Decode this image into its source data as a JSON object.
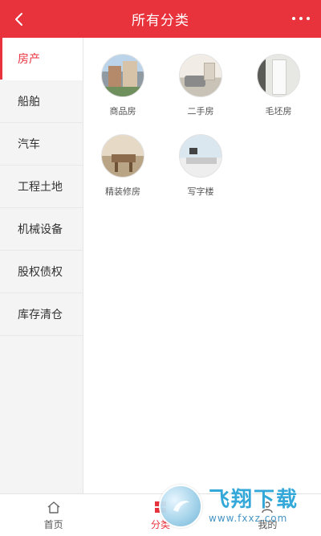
{
  "header": {
    "title": "所有分类",
    "back_icon": "chevron-left-icon",
    "more_icon": "more-dots-icon"
  },
  "sidebar": {
    "items": [
      {
        "label": "房产",
        "active": true
      },
      {
        "label": "船舶"
      },
      {
        "label": "汽车"
      },
      {
        "label": "工程土地"
      },
      {
        "label": "机械设备"
      },
      {
        "label": "股权债权"
      },
      {
        "label": "库存清仓"
      }
    ]
  },
  "categories": [
    {
      "label": "商品房"
    },
    {
      "label": "二手房"
    },
    {
      "label": "毛坯房"
    },
    {
      "label": "精装修房"
    },
    {
      "label": "写字楼"
    }
  ],
  "tabbar": {
    "items": [
      {
        "label": "首页",
        "icon": "home-icon"
      },
      {
        "label": "分类",
        "icon": "category-grid-icon",
        "active": true
      },
      {
        "label": "我的",
        "icon": "user-icon"
      }
    ]
  },
  "watermark": {
    "main": "飞翔下载",
    "sub": "www.fxxz.com"
  },
  "colors": {
    "accent": "#e8323c",
    "sidebar_bg": "#f4f4f4"
  }
}
